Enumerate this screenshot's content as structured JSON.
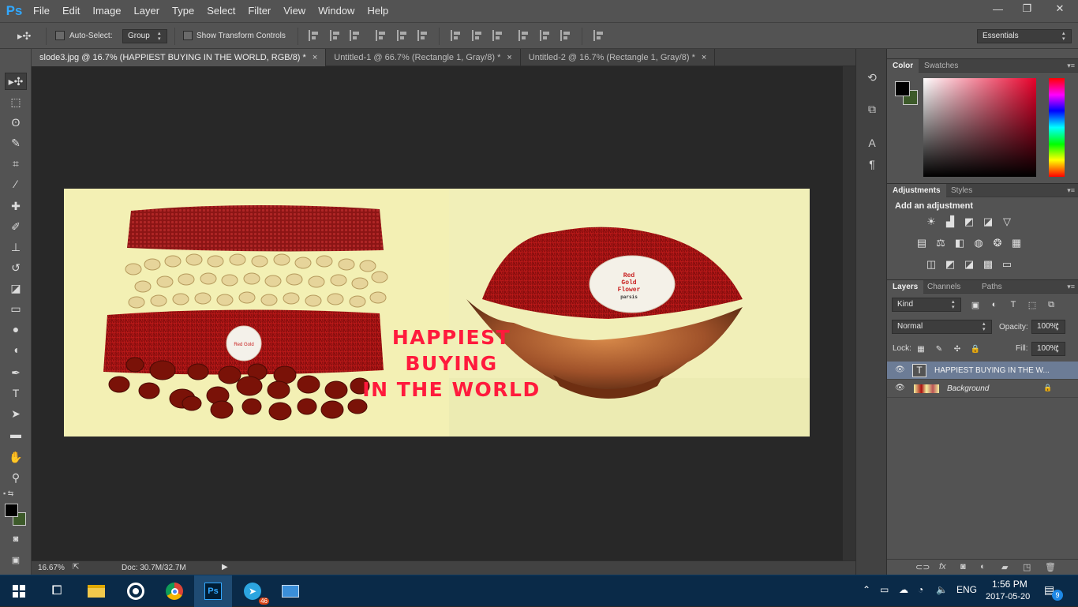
{
  "app": {
    "logo_text": "Ps"
  },
  "menu": [
    "File",
    "Edit",
    "Image",
    "Layer",
    "Type",
    "Select",
    "Filter",
    "View",
    "Window",
    "Help"
  ],
  "window_controls": {
    "minimize": "—",
    "restore": "❐",
    "close": "✕"
  },
  "options": {
    "auto_select_label": "Auto-Select:",
    "auto_select_value": "Group",
    "show_transform_label": "Show Transform Controls",
    "workspace": "Essentials"
  },
  "tabs": [
    {
      "label": "slode3.jpg @ 16.7% (HAPPIEST  BUYING  IN THE WORLD, RGB/8) *",
      "close": "×"
    },
    {
      "label": "Untitled-1 @ 66.7% (Rectangle 1, Gray/8) *",
      "close": "×"
    },
    {
      "label": "Untitled-2 @ 16.7% (Rectangle 1, Gray/8) *",
      "close": "×"
    }
  ],
  "image": {
    "headline_1": "HAPPIEST",
    "headline_2": "BUYING",
    "headline_3": "IN THE WORLD",
    "label_line1": "Red",
    "label_line2": "Gold",
    "label_line3": "Flower",
    "label_line4": "parsis",
    "headline_color": "#ff1a3c"
  },
  "status": {
    "zoom": "16.67%",
    "doc": "Doc: 30.7M/32.7M"
  },
  "panels": {
    "color_tabs": [
      "Color",
      "Swatches"
    ],
    "adj_tabs": [
      "Adjustments",
      "Styles"
    ],
    "add_adjustment": "Add an adjustment",
    "layer_tabs": [
      "Layers",
      "Channels",
      "Paths"
    ],
    "kind": "Kind",
    "blend_mode": "Normal",
    "opacity_label": "Opacity:",
    "opacity_value": "100%",
    "lock_label": "Lock:",
    "fill_label": "Fill:",
    "fill_value": "100%",
    "layers": [
      {
        "name": "HAPPIEST  BUYING  IN THE W...",
        "type": "text",
        "selected": true
      },
      {
        "name": "Background",
        "type": "image",
        "selected": false
      }
    ]
  },
  "taskbar": {
    "time": "1:56 PM",
    "date": "2017-05-20",
    "lang": "ENG",
    "telegram_badge": "46",
    "notif_badge": "9"
  },
  "colors": {
    "accent": "#31a8ff",
    "panel": "#535353",
    "dark": "#282828",
    "taskbar": "#0a2a48"
  }
}
